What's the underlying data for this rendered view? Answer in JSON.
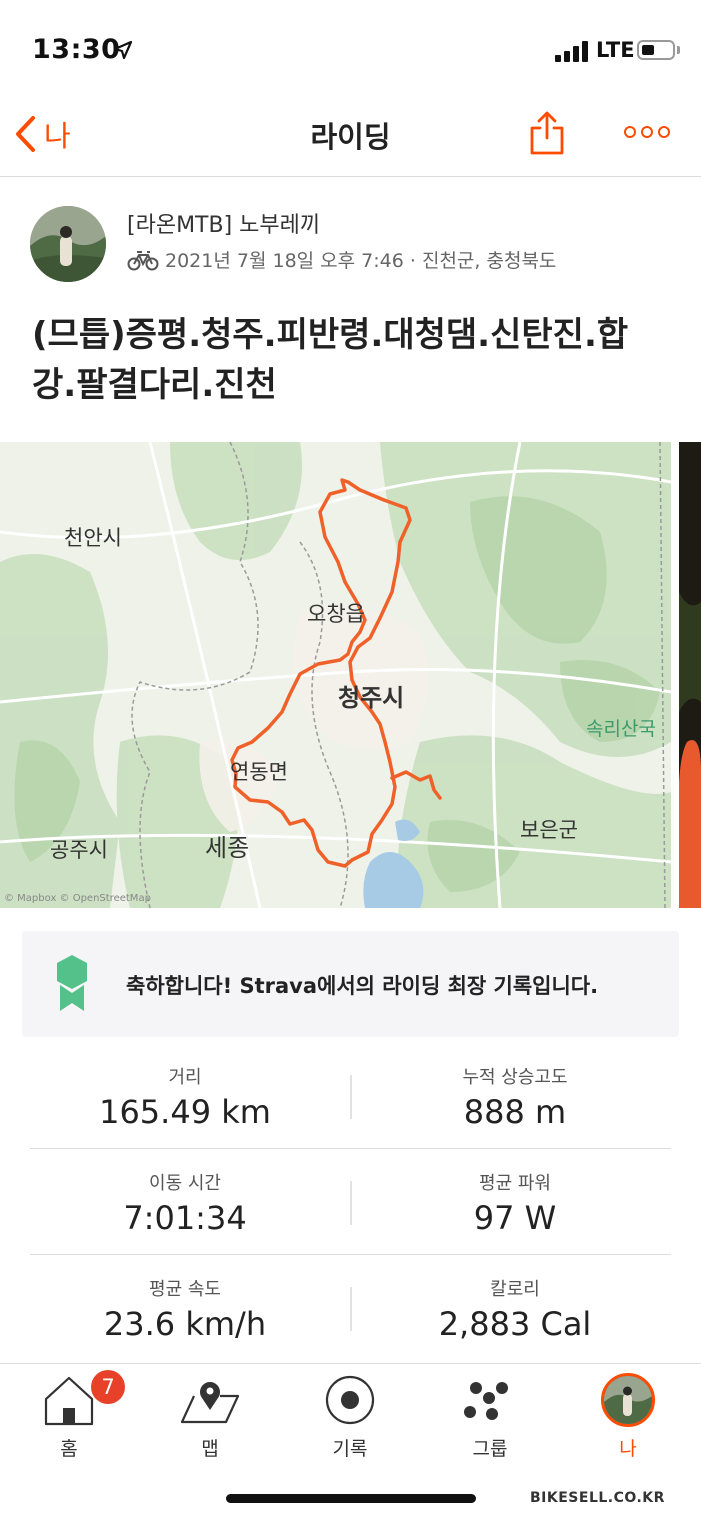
{
  "status_bar": {
    "time": "13:30",
    "carrier": "LTE"
  },
  "nav": {
    "back_label": "나",
    "title": "라이딩"
  },
  "athlete": {
    "name": "[라온MTB] 노부레끼",
    "date_location": "2021년 7월 18일 오후 7:46 · 진천군, 충청북도"
  },
  "activity": {
    "title": "(므틉)증평.청주.피반령.대청댐.신탄진.합강.팔결다리.진천"
  },
  "map": {
    "labels": {
      "cheonan": "천안시",
      "ochang": "오창읍",
      "cheongju": "청주시",
      "songnisan": "속리산국",
      "yeondong": "연동면",
      "sejong": "세종",
      "gongju": "공주시",
      "boeun": "보은군"
    },
    "attribution": "© Mapbox © OpenStreetMap",
    "route_color": "#f0612a"
  },
  "achievement": {
    "text": "축하합니다! Strava에서의 라이딩 최장 기록입니다.",
    "icon": "medal-icon",
    "color": "#54c08a"
  },
  "stats": [
    {
      "left_label": "거리",
      "left_value": "165.49 km",
      "right_label": "누적 상승고도",
      "right_value": "888 m"
    },
    {
      "left_label": "이동 시간",
      "left_value": "7:01:34",
      "right_label": "평균 파워",
      "right_value": "97 W"
    },
    {
      "left_label": "평균 속도",
      "left_value": "23.6 km/h",
      "right_label": "칼로리",
      "right_value": "2,883 Cal"
    }
  ],
  "tabs": {
    "home": "홈",
    "home_badge": "7",
    "map": "맵",
    "record": "기록",
    "groups": "그룹",
    "me": "나"
  },
  "watermark": "BIKESELL.CO.KR",
  "accent_color": "#fc4c02"
}
